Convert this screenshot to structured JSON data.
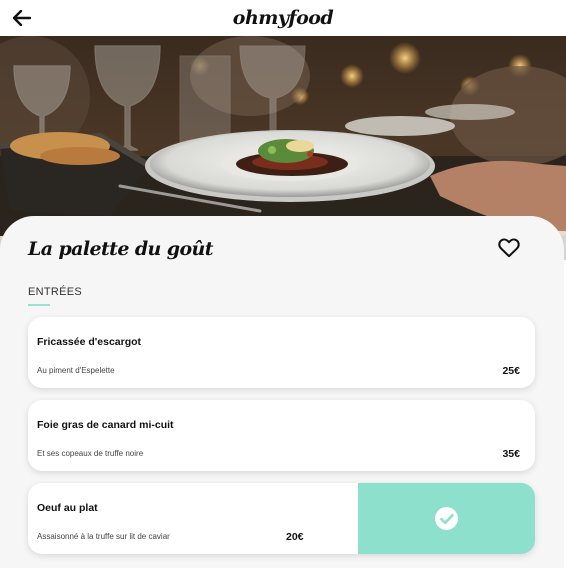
{
  "header": {
    "logo": "ohmyfood",
    "back_icon": "arrow-left-icon"
  },
  "hero": {
    "image": "restaurant-dining-table-photo"
  },
  "restaurant": {
    "name": "La palette du goût",
    "favorite_icon": "heart-outline-icon",
    "favorited": false
  },
  "section": {
    "label": "ENTRÉES",
    "accent_color": "#99e2d0"
  },
  "dishes": [
    {
      "name": "Fricassée d'escargot",
      "description": "Au piment d'Espelette",
      "price": "25€",
      "selected": false
    },
    {
      "name": "Foie gras de canard mi-cuit",
      "description": "Et ses copeaux de truffe noire",
      "price": "35€",
      "selected": false
    },
    {
      "name": "Oeuf au plat",
      "description": "Assaisonné à la truffe sur lit de caviar",
      "price": "20€",
      "selected": true
    }
  ],
  "colors": {
    "selected_panel": "#8de0cc",
    "sheet_background": "#f6f6f6"
  }
}
